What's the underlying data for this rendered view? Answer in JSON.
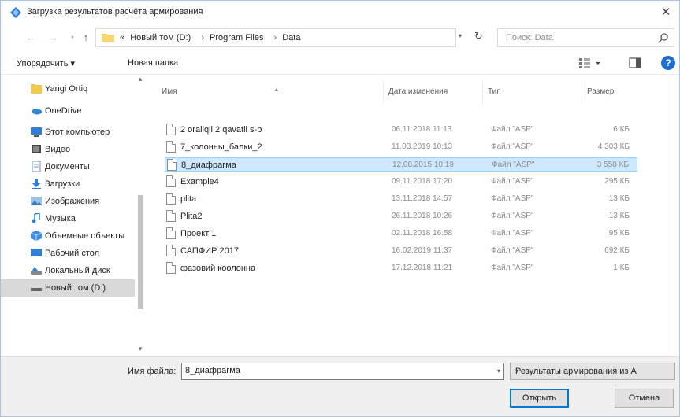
{
  "window": {
    "title": "Загрузка результатов расчёта армирования",
    "close_glyph": "✕"
  },
  "address": {
    "crumbs": [
      "«",
      "Новый том (D:)",
      "›",
      "Program Files",
      "›",
      "Data"
    ],
    "search_placeholder": "Поиск: Data"
  },
  "toolbar": {
    "organize_label": "Упорядочить ▾",
    "new_folder_label": "Новая папка",
    "help_label": "?"
  },
  "nav": {
    "items": [
      {
        "label": "Yangi Ortiq",
        "icon": "folder-icon"
      },
      {
        "label": "OneDrive",
        "icon": "cloud-icon"
      },
      {
        "label": "Этот компьютер",
        "icon": "computer-icon"
      },
      {
        "label": "Видео",
        "icon": "video-icon"
      },
      {
        "label": "Документы",
        "icon": "documents-icon"
      },
      {
        "label": "Загрузки",
        "icon": "downloads-icon"
      },
      {
        "label": "Изображения",
        "icon": "pictures-icon"
      },
      {
        "label": "Музыка",
        "icon": "music-icon"
      },
      {
        "label": "Объемные объекты",
        "icon": "3d-objects-icon"
      },
      {
        "label": "Рабочий стол",
        "icon": "desktop-icon"
      },
      {
        "label": "Локальный диск",
        "icon": "drive-icon"
      },
      {
        "label": "Новый том (D:)",
        "icon": "drive-icon"
      }
    ]
  },
  "files": {
    "columns": {
      "name": "Имя",
      "date": "Дата изменения",
      "type": "Тип",
      "size": "Размер"
    },
    "rows": [
      {
        "name": "2 oraliqli 2 qavatli s-b",
        "date": "06.11.2018 11:13",
        "type": "Файл \"ASP\"",
        "size": "6 КБ"
      },
      {
        "name": "7_колонны_балки_2",
        "date": "11.03.2019 10:13",
        "type": "Файл \"ASP\"",
        "size": "4 303 КБ"
      },
      {
        "name": "8_диафрагма",
        "date": "12.08.2015 10:19",
        "type": "Файл \"ASP\"",
        "size": "3 558 КБ"
      },
      {
        "name": "Example4",
        "date": "09.11.2018 17:20",
        "type": "Файл \"ASP\"",
        "size": "295 КБ"
      },
      {
        "name": "plita",
        "date": "13.11.2018 14:57",
        "type": "Файл \"ASP\"",
        "size": "13 КБ"
      },
      {
        "name": "Plita2",
        "date": "26.11.2018 10:26",
        "type": "Файл \"ASP\"",
        "size": "13 КБ"
      },
      {
        "name": "Проект 1",
        "date": "02.11.2018 16:58",
        "type": "Файл \"ASP\"",
        "size": "95 КБ"
      },
      {
        "name": "САПФИР 2017",
        "date": "16.02.2019 11:37",
        "type": "Файл \"ASP\"",
        "size": "692 КБ"
      },
      {
        "name": "фазовий коолонна",
        "date": "17.12.2018 11:21",
        "type": "Файл \"ASP\"",
        "size": "1 КБ"
      }
    ]
  },
  "bottom": {
    "filename_label": "Имя файла:",
    "filename_value": "8_диафрагма",
    "filetype_value": "Результаты армирования из А",
    "open_label": "Открыть",
    "cancel_label": "Отмена"
  },
  "colors": {
    "selection_bg": "#cde8ff",
    "accent": "#0078d7"
  }
}
